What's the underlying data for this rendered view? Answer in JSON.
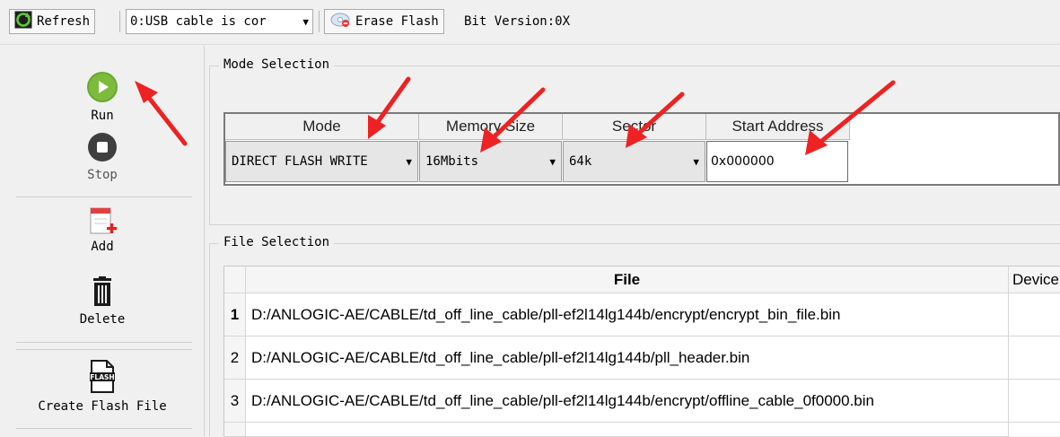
{
  "toolbar": {
    "refresh_label": "Refresh",
    "cable_select_value": "0:USB cable is cor",
    "erase_label": "Erase Flash",
    "bit_version_text": "Bit Version:0X"
  },
  "sidebar": {
    "run_label": "Run",
    "stop_label": "Stop",
    "add_label": "Add",
    "delete_label": "Delete",
    "create_flash_label": "Create Flash File",
    "flash_icon_text": "FLASH"
  },
  "mode_selection": {
    "title": "Mode Selection",
    "headers": {
      "mode": "Mode",
      "memory_size": "Memory Size",
      "sector": "Sector",
      "start_address": "Start Address"
    },
    "values": {
      "mode": "DIRECT FLASH WRITE",
      "memory_size": "16Mbits",
      "sector": "64k",
      "start_address": "0x000000"
    }
  },
  "file_selection": {
    "title": "File Selection",
    "headers": {
      "file": "File",
      "device": "Device"
    },
    "rows": [
      {
        "num": "1",
        "path": "D:/ANLOGIC-AE/CABLE/td_off_line_cable/pll-ef2l14lg144b/encrypt/encrypt_bin_file.bin"
      },
      {
        "num": "2",
        "path": "D:/ANLOGIC-AE/CABLE/td_off_line_cable/pll-ef2l14lg144b/pll_header.bin"
      },
      {
        "num": "3",
        "path": "D:/ANLOGIC-AE/CABLE/td_off_line_cable/pll-ef2l14lg144b/encrypt/offline_cable_0f0000.bin"
      }
    ]
  },
  "colors": {
    "run_green": "#6aa832",
    "stop_gray": "#3f3f3f",
    "arrow_red": "#ee2222"
  }
}
